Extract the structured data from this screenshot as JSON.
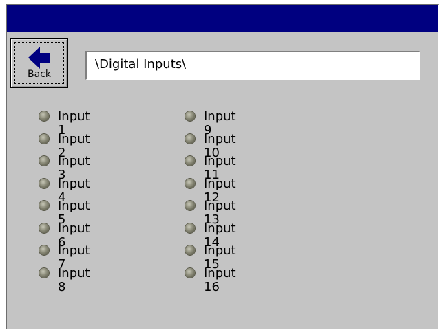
{
  "header": {
    "back_label": "Back",
    "back_icon": "left-arrow-icon"
  },
  "path": {
    "value": "\\Digital Inputs\\"
  },
  "colors": {
    "titlebar": "#000080",
    "background": "#c4c4c4",
    "led": "#8a8a78"
  },
  "inputs_left": [
    {
      "label": "Input 1"
    },
    {
      "label": "Input 2"
    },
    {
      "label": "Input 3"
    },
    {
      "label": "Input 4"
    },
    {
      "label": "Input 5"
    },
    {
      "label": "Input 6"
    },
    {
      "label": "Input 7"
    },
    {
      "label": "Input 8"
    }
  ],
  "inputs_right": [
    {
      "label": "Input 9"
    },
    {
      "label": "Input 10"
    },
    {
      "label": "Input 11"
    },
    {
      "label": "Input 12"
    },
    {
      "label": "Input 13"
    },
    {
      "label": "Input 14"
    },
    {
      "label": "Input 15"
    },
    {
      "label": "Input 16"
    }
  ]
}
